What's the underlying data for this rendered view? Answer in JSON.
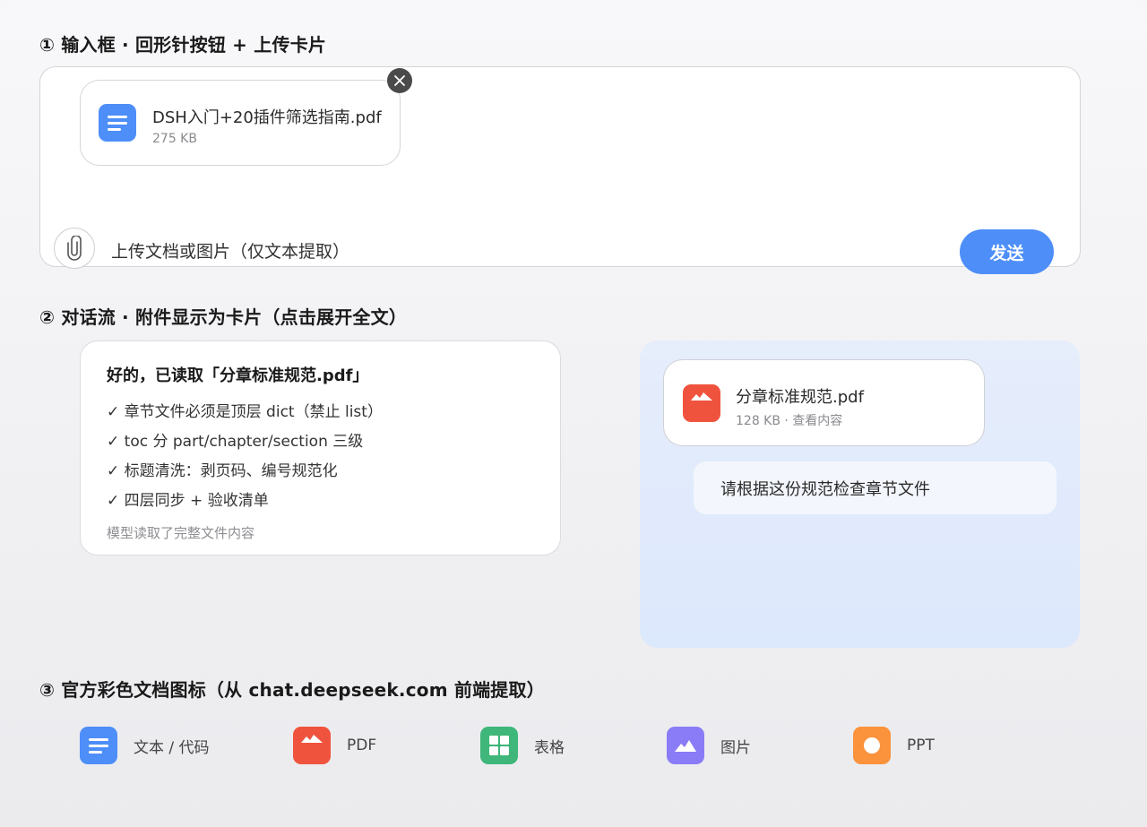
{
  "section1": {
    "title": "① 输入框 · 回形针按钮 + 上传卡片",
    "upload_card": {
      "file_name": "DSH入门+20插件筛选指南.pdf",
      "file_size": "275 KB",
      "icon": "doc-icon"
    },
    "placeholder": "上传文档或图片（仅文本提取）",
    "send_label": "发送",
    "colors": {
      "send": "#4d8ef8",
      "doc_icon": "#4d8ef8"
    }
  },
  "section2": {
    "title": "② 对话流 · 附件显示为卡片（点击展开全文）",
    "reply": {
      "title": "好的，已读取「分章标准规范.pdf」",
      "lines": [
        "✓ 章节文件必须是顶层 dict（禁止 list）",
        "✓ toc 分 part/chapter/section 三级",
        "✓ 标题清洗：剥页码、编号规范化",
        "✓ 四层同步 + 验收清单"
      ],
      "note": "模型读取了完整文件内容"
    },
    "attachment": {
      "file_name": "分章标准规范.pdf",
      "meta": "128 KB · 查看内容",
      "icon": "pdf-icon"
    },
    "user_message": "请根据这份规范检查章节文件"
  },
  "section3": {
    "title": "③ 官方彩色文档图标（从 chat.deepseek.com 前端提取）",
    "icons": [
      {
        "label": "文本 / 代码",
        "icon": "text-doc-icon",
        "color": "#4d8ef8"
      },
      {
        "label": "PDF",
        "icon": "pdf-icon",
        "color": "#f0533d"
      },
      {
        "label": "表格",
        "icon": "spreadsheet-icon",
        "color": "#3fb67a"
      },
      {
        "label": "图片",
        "icon": "image-icon",
        "color": "#8a7cf6"
      },
      {
        "label": "PPT",
        "icon": "ppt-icon",
        "color": "#fb923c"
      }
    ]
  }
}
